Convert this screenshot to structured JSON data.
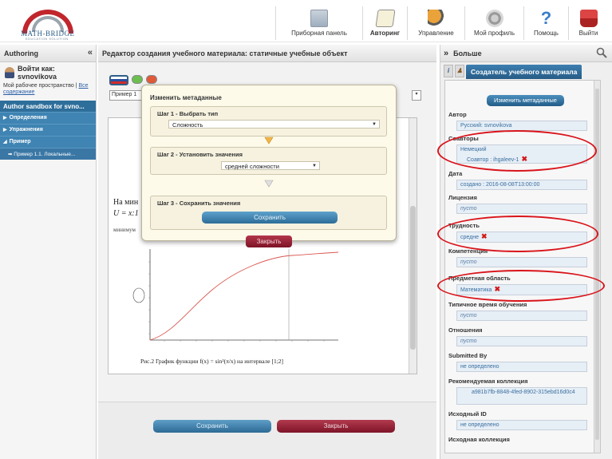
{
  "logo": {
    "name": "MATH-BRIDGE",
    "sub": "EDUCATION SOLUTION"
  },
  "nav": [
    {
      "label": "Приборная панель",
      "icon": "dashboard-icon"
    },
    {
      "label": "Авторинг",
      "icon": "authoring-icon",
      "active": true
    },
    {
      "label": "Управление",
      "icon": "management-icon"
    },
    {
      "label": "Мой профиль",
      "icon": "profile-icon"
    },
    {
      "label": "Помощь",
      "icon": "help-icon"
    },
    {
      "label": "Выйти",
      "icon": "exit-icon"
    }
  ],
  "left": {
    "title": "Authoring",
    "login": "Войти как: svnovikova",
    "workspace_text": "Мой рабочее пространство |",
    "workspace_link": "Все содержание",
    "tree_root": "Author sandbox for svno...",
    "items": [
      "Определения",
      "Упражнения",
      "Пример"
    ],
    "sub_item": "Пример 1.1. Локальные..."
  },
  "center": {
    "title": "Редактор создания учебного материала: статичные учебные объект",
    "example_select": "Пример 1",
    "text_line1": "На мин",
    "text_line2": "U = x:1",
    "text_line3": "минимум",
    "caption": "Рис.2 График функции f(x) = sin²(π/x) на интервале [1;2]",
    "save": "Сохранить",
    "close": "Закрыть"
  },
  "modal": {
    "title": "Изменить метаданные",
    "step1_label": "Шаг 1 - Выбрать тип",
    "step1_value": "Сложность",
    "step2_label": "Шаг 2 - Установить значения",
    "step2_value": "средней сложности",
    "step3_label": "Шаг 3 - Сохранить значения",
    "save": "Сохранить",
    "close": "Закрыть"
  },
  "right": {
    "title": "Больше",
    "tab": "Создатель учебного материала",
    "edit_button": "Изменить метаданные",
    "fields": [
      {
        "label": "Автор",
        "value": "Русский: svnovikova"
      },
      {
        "label": "Соавторы",
        "value": "Немецкий",
        "value2": "Соавтор : ihgaleev-1"
      },
      {
        "label": "Дата",
        "value": "создано : 2016-08-08T13:00:00"
      },
      {
        "label": "Лицензия",
        "value": "пусто"
      },
      {
        "label": "Трудность",
        "value": "средне"
      },
      {
        "label": "Компетенция",
        "value": "пусто"
      },
      {
        "label": "Предметная область",
        "value": "Математика"
      },
      {
        "label": "Типичное время обучения",
        "value": "пусто"
      },
      {
        "label": "Отношения",
        "value": "пусто"
      },
      {
        "label": "Submitted By",
        "value": "не определено"
      },
      {
        "label": "Рекомендуемая коллекция",
        "value": "a981b7fb-8848-4fed-8902-315ebd16d0c4"
      },
      {
        "label": "Исходный ID",
        "value": "не определено"
      },
      {
        "label": "Исходная коллекция",
        "value": ""
      }
    ]
  },
  "colors": {
    "accent_blue": "#2d6e9a",
    "accent_red": "#7e1428",
    "highlight": "#d9141b"
  }
}
